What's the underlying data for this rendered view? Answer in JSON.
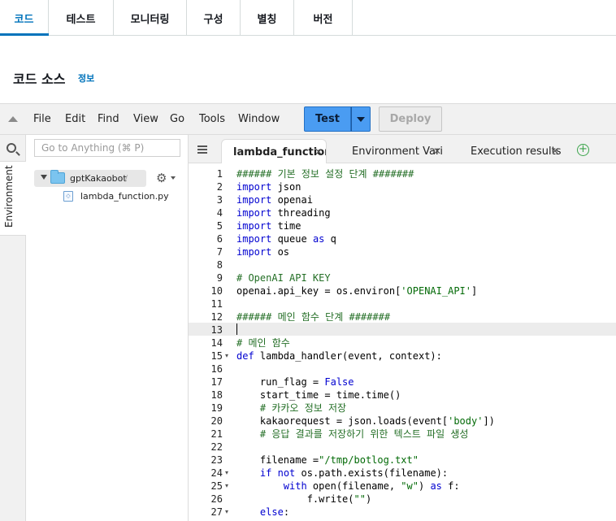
{
  "top_tabs": [
    {
      "label": "코드",
      "active": true
    },
    {
      "label": "테스트"
    },
    {
      "label": "모니터링"
    },
    {
      "label": "구성"
    },
    {
      "label": "별칭"
    },
    {
      "label": "버전"
    }
  ],
  "section": {
    "title": "코드 소스",
    "info": "정보"
  },
  "menu": [
    "File",
    "Edit",
    "Find",
    "View",
    "Go",
    "Tools",
    "Window"
  ],
  "buttons": {
    "test": "Test",
    "deploy": "Deploy"
  },
  "sidebar": {
    "env_label": "Environment",
    "search_placeholder": "Go to Anything (⌘ P)",
    "folder": {
      "name": "gptKakaobot",
      "suffix": "- /"
    },
    "file": {
      "name": "lambda_function.py"
    }
  },
  "editor_tabs": [
    {
      "label": "lambda_function",
      "active": true
    },
    {
      "label": "Environment Vari"
    },
    {
      "label": "Execution results"
    }
  ],
  "code_lines": [
    {
      "n": "1",
      "text": "###### 기본 정보 설정 단계 #######"
    },
    {
      "n": "2",
      "text": "import json"
    },
    {
      "n": "3",
      "text": "import openai"
    },
    {
      "n": "4",
      "text": "import threading"
    },
    {
      "n": "5",
      "text": "import time"
    },
    {
      "n": "6",
      "text": "import queue as q"
    },
    {
      "n": "7",
      "text": "import os"
    },
    {
      "n": "8",
      "text": ""
    },
    {
      "n": "9",
      "text": "# OpenAI API KEY"
    },
    {
      "n": "10",
      "text": "openai.api_key = os.environ['OPENAI_API']"
    },
    {
      "n": "11",
      "text": ""
    },
    {
      "n": "12",
      "text": "###### 메인 함수 단계 #######"
    },
    {
      "n": "13",
      "text": ""
    },
    {
      "n": "14",
      "text": "# 메인 함수"
    },
    {
      "n": "15",
      "text": "def lambda_handler(event, context):"
    },
    {
      "n": "16",
      "text": ""
    },
    {
      "n": "17",
      "text": "    run_flag = False"
    },
    {
      "n": "18",
      "text": "    start_time = time.time()"
    },
    {
      "n": "19",
      "text": "    # 카카오 정보 저장"
    },
    {
      "n": "20",
      "text": "    kakaorequest = json.loads(event['body'])"
    },
    {
      "n": "21",
      "text": "    # 응답 결과를 저장하기 위한 텍스트 파일 생성"
    },
    {
      "n": "22",
      "text": ""
    },
    {
      "n": "23",
      "text": "    filename =\"/tmp/botlog.txt\""
    },
    {
      "n": "24",
      "text": "    if not os.path.exists(filename):"
    },
    {
      "n": "25",
      "text": "        with open(filename, \"w\") as f:"
    },
    {
      "n": "26",
      "text": "            f.write(\"\")"
    },
    {
      "n": "27",
      "text": "    else:"
    }
  ]
}
